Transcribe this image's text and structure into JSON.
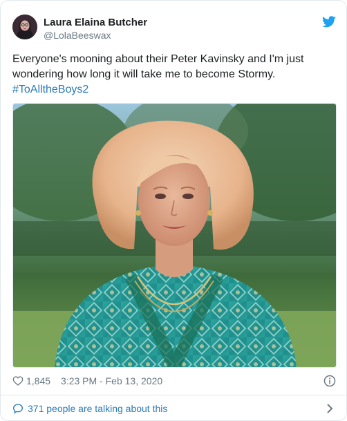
{
  "author": {
    "display_name": "Laura Elaina Butcher",
    "handle": "@LolaBeeswax"
  },
  "tweet": {
    "text_line1": "Everyone's mooning about their Peter Kavinsky and I'm just",
    "text_line2": "wondering how long it will take me to become Stormy.",
    "hashtag": "#ToAlltheBoys2"
  },
  "meta": {
    "like_count": "1,845",
    "timestamp": "3:23 PM - Feb 13, 2020"
  },
  "footer": {
    "talking_label": "371 people are talking about this"
  },
  "icons": {
    "brand": "twitter-bird-icon",
    "like": "heart-icon",
    "info": "info-icon",
    "conversation": "speech-bubble-icon",
    "more": "chevron-right-icon"
  },
  "colors": {
    "link": "#2b7bb9",
    "twitter_blue": "#1da1f2",
    "secondary_text": "#697882",
    "primary_text": "#1c2022",
    "border": "#e1e8ed"
  }
}
